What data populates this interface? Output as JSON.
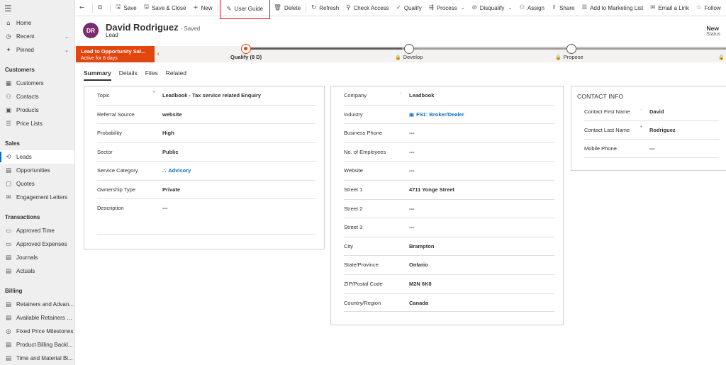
{
  "sidebar": {
    "top": [
      {
        "icon": "⌂",
        "label": "Home"
      },
      {
        "icon": "◷",
        "label": "Recent",
        "chevron": "⌄"
      },
      {
        "icon": "✦",
        "label": "Pinned",
        "chevron": "⌄"
      }
    ],
    "sections": [
      {
        "title": "Customers",
        "items": [
          {
            "icon": "▦",
            "label": "Customers"
          },
          {
            "icon": "⚇",
            "label": "Contacts"
          },
          {
            "icon": "▣",
            "label": "Products"
          },
          {
            "icon": "☰",
            "label": "Price Lists"
          }
        ]
      },
      {
        "title": "Sales",
        "items": [
          {
            "icon": "⟲",
            "label": "Leads",
            "active": true
          },
          {
            "icon": "▤",
            "label": "Opportunities"
          },
          {
            "icon": "▢",
            "label": "Quotes"
          },
          {
            "icon": "✉",
            "label": "Engagement Letters"
          }
        ]
      },
      {
        "title": "Transactions",
        "items": [
          {
            "icon": "▭",
            "label": "Approved Time"
          },
          {
            "icon": "▭",
            "label": "Approved Expenses"
          },
          {
            "icon": "▤",
            "label": "Journals"
          },
          {
            "icon": "▤",
            "label": "Actuals"
          }
        ]
      },
      {
        "title": "Billing",
        "items": [
          {
            "icon": "▤",
            "label": "Retainers and Advan..."
          },
          {
            "icon": "▤",
            "label": "Available Retainers a..."
          },
          {
            "icon": "◎",
            "label": "Fixed Price Milestones"
          },
          {
            "icon": "▤",
            "label": "Product Billing Backl..."
          },
          {
            "icon": "▤",
            "label": "Time and Material Bi..."
          }
        ]
      }
    ]
  },
  "toolbar": {
    "back": "←",
    "popout": "⧉",
    "items": [
      {
        "icon": "🖫",
        "label": "Save"
      },
      {
        "icon": "🖫",
        "label": "Save & Close"
      },
      {
        "icon": "+",
        "label": "New",
        "green": true
      },
      {
        "icon": "✎",
        "label": "User Guide",
        "highlight": true
      },
      {
        "icon": "🗑",
        "label": "Delete"
      },
      {
        "icon": "↻",
        "label": "Refresh"
      },
      {
        "icon": "⚲",
        "label": "Check Access"
      },
      {
        "icon": "✓",
        "label": "Qualify"
      },
      {
        "icon": "⇶",
        "label": "Process",
        "caret": "⌄"
      },
      {
        "icon": "⊘",
        "label": "Disqualify",
        "caret": "⌄"
      },
      {
        "icon": "⚇",
        "label": "Assign"
      },
      {
        "icon": "⇪",
        "label": "Share"
      },
      {
        "icon": "☰",
        "label": "Add to Marketing List"
      },
      {
        "icon": "✉",
        "label": "Email a Link"
      },
      {
        "icon": "☆",
        "label": "Follow"
      }
    ]
  },
  "header": {
    "initials": "DR",
    "avatar_color": "#7a2c6e",
    "name": "David Rodriguez",
    "saved": "- Saved",
    "entity": "Lead",
    "status_value": "New",
    "status_label": "Status"
  },
  "process": {
    "active_title": "Lead to Opportunity Sal...",
    "active_sub": "Active for 8 days",
    "back": "‹",
    "accent": "#e2450d",
    "stages": [
      {
        "label": "Qualify  (8 D)",
        "active": true,
        "locked": false
      },
      {
        "label": "Develop",
        "active": false,
        "locked": true
      },
      {
        "label": "Propose",
        "active": false,
        "locked": true
      }
    ],
    "lock": "🔒"
  },
  "tabs": [
    "Summary",
    "Details",
    "Files",
    "Related"
  ],
  "summary": [
    {
      "label": "Topic",
      "req": "*",
      "value": "Leadbook - Tax service related Enquiry"
    },
    {
      "label": "Referral Source",
      "value": "website"
    },
    {
      "label": "Probability",
      "value": "High"
    },
    {
      "label": "Sector",
      "value": "Public"
    },
    {
      "label": "Service Category",
      "value": "Advisory",
      "link": true,
      "icon": "⛬"
    },
    {
      "label": "Ownership Type",
      "value": "Private"
    },
    {
      "label": "Description",
      "value": "---"
    }
  ],
  "company": [
    {
      "label": "Company",
      "req": "·",
      "value": "Leadbook"
    },
    {
      "label": "Industry",
      "value": "FS1: Broker/Dealer",
      "link": true,
      "icon": "▣"
    },
    {
      "label": "Business Phone",
      "value": "---"
    },
    {
      "label": "No. of Employees",
      "value": "---"
    },
    {
      "label": "Website",
      "value": "---"
    },
    {
      "label": "Street 1",
      "value": "4711 Yonge Street"
    },
    {
      "label": "Street 2",
      "value": "---"
    },
    {
      "label": "Street 3",
      "value": "---"
    },
    {
      "label": "City",
      "value": "Brampton"
    },
    {
      "label": "State/Province",
      "value": "Ontario"
    },
    {
      "label": "ZIP/Postal Code",
      "value": "M2N 6K8"
    },
    {
      "label": "Country/Region",
      "value": "Canada"
    }
  ],
  "contact": {
    "title": "CONTACT INFO",
    "rows": [
      {
        "label": "Contact First Name",
        "req": "·",
        "value": "David"
      },
      {
        "label": "Contact Last Name",
        "req": "*",
        "value": "Rodriguez"
      },
      {
        "label": "Mobile Phone",
        "value": "---"
      }
    ]
  }
}
